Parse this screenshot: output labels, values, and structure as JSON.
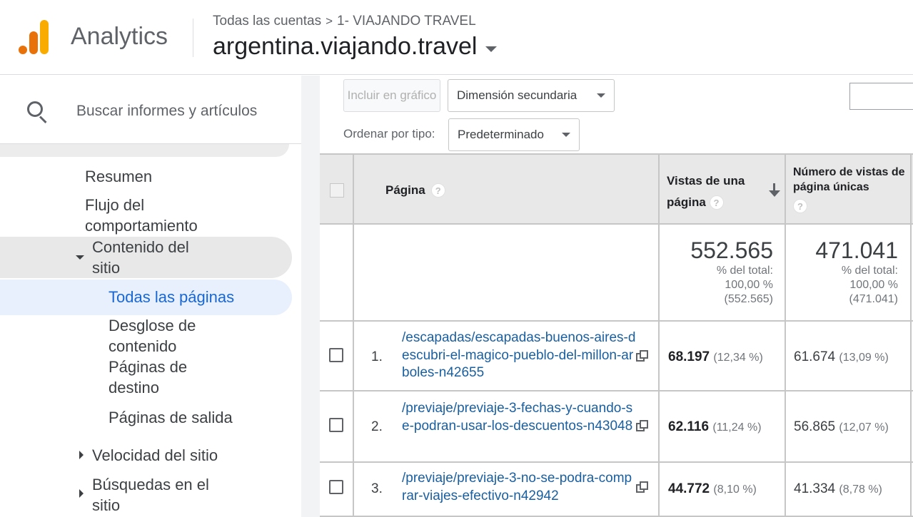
{
  "header": {
    "app_name": "Analytics",
    "breadcrumb": [
      "Todas las cuentas",
      "1- VIAJANDO TRAVEL"
    ],
    "breadcrumb_sep": ">",
    "property": "argentina.viajando.travel"
  },
  "sidebar": {
    "search_placeholder": "Buscar informes y artículos",
    "items": [
      {
        "label": "Resumen"
      },
      {
        "label": "Flujo del comportamiento"
      },
      {
        "label": "Contenido del sitio"
      },
      {
        "label": "Todas las páginas"
      },
      {
        "label": "Desglose de contenido"
      },
      {
        "label": "Páginas de destino"
      },
      {
        "label": "Páginas de salida"
      },
      {
        "label": "Velocidad del sitio"
      },
      {
        "label": "Búsquedas en el sitio"
      }
    ]
  },
  "toolbar": {
    "include_label": "Incluir en gráfico",
    "secondary_dim": "Dimensión secundaria",
    "sort_label": "Ordenar por tipo:",
    "sort_value": "Predeterminado"
  },
  "table": {
    "col_page": "Página",
    "col_views": "Vistas de una página",
    "col_unique": "Número de vistas de página únicas",
    "help": "?",
    "totals": {
      "views": "552.565",
      "views_pct_label": "% del total:",
      "views_pct": "100,00 %",
      "views_total": "(552.565)",
      "unique": "471.041",
      "unique_pct_label": "% del total:",
      "unique_pct": "100,00 %",
      "unique_total": "(471.041)"
    },
    "rows": [
      {
        "num": "1.",
        "page": "/escapadas/escapadas-buenos-aires-descubri-el-magico-pueblo-del-millon-arboles-n42655",
        "views": "68.197",
        "views_pct": "(12,34 %)",
        "unique": "61.674",
        "unique_pct": "(13,09 %)"
      },
      {
        "num": "2.",
        "page": "/previaje/previaje-3-fechas-y-cuando-se-podran-usar-los-descuentos-n43048",
        "views": "62.116",
        "views_pct": "(11,24 %)",
        "unique": "56.865",
        "unique_pct": "(12,07 %)"
      },
      {
        "num": "3.",
        "page": "/previaje/previaje-3-no-se-podra-comprar-viajes-efectivo-n42942",
        "views": "44.772",
        "views_pct": "(8,10 %)",
        "unique": "41.334",
        "unique_pct": "(8,78 %)"
      }
    ]
  }
}
